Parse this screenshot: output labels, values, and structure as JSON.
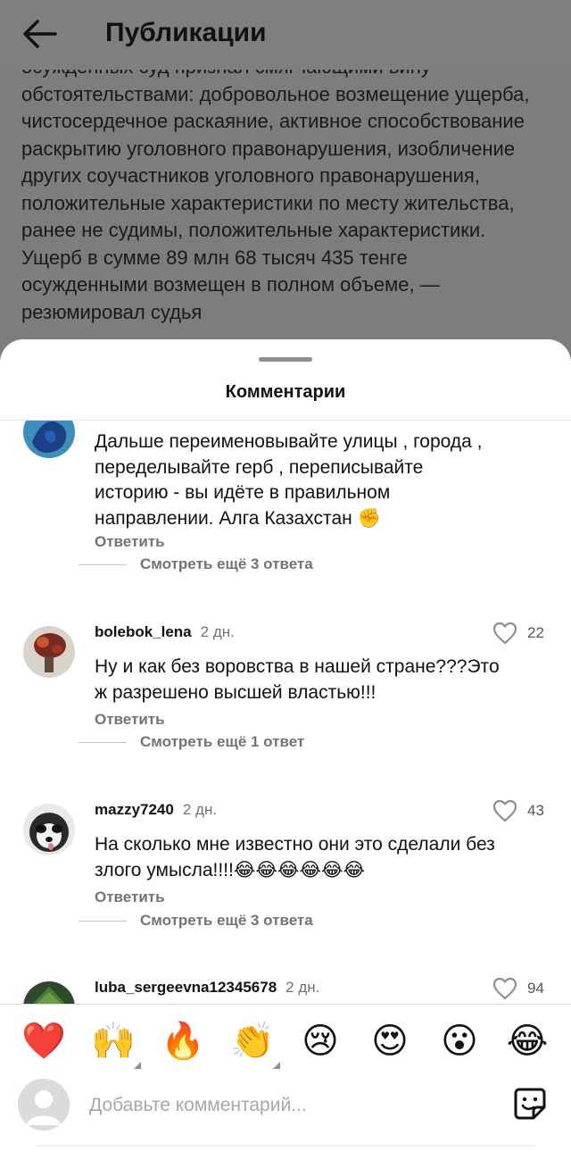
{
  "header": {
    "title": "Публикации",
    "back_icon": "arrow-left-icon"
  },
  "post_text": {
    "lines": [
      "осужденных суд признал смягчающими вину",
      "обстоятельствами: добровольное возмещение ущерба,",
      "чистосердечное раскаяние, активное способствование",
      "раскрытию уголовного правонарушения, изобличение",
      "других соучастников уголовного правонарушения,",
      "положительные характеристики по месту жительства,",
      "ранее не судимы, положительные характеристики.",
      "Ущерб в сумме 89 млн 68 тысяч 435 тенге",
      "осужденными возмещен в полном объеме, —",
      "резюмировал судья"
    ]
  },
  "sheet": {
    "title": "Комментарии"
  },
  "comments": [
    {
      "user": "",
      "time": "",
      "text_lines": [
        "Дальше переименовывайте улицы , города ,",
        "переделывайте герб , переписывайте",
        "историю - вы идёте в правильном",
        "направлении. Алга Казахстан ✊"
      ],
      "reply": "Ответить",
      "view_replies": "Смотреть ещё 3 ответа"
    },
    {
      "user": "bolebok_lena",
      "time": "2 дн.",
      "likes": "22",
      "text_lines": [
        "Ну и как без воровства в нашей стране???Это",
        "ж разрешено высшей властью!!!"
      ],
      "reply": "Ответить",
      "view_replies": "Смотреть ещё 1 ответ"
    },
    {
      "user": "mazzy7240",
      "time": "2 дн.",
      "likes": "43",
      "text_lines": [
        "На сколько мне известно они это сделали без",
        "злого умысла!!!!😂😂😂😂😂😂"
      ],
      "reply": "Ответить",
      "view_replies": "Смотреть ещё 3 ответа"
    },
    {
      "user": "luba_sergeevna12345678",
      "time": "2 дн.",
      "likes": "94"
    }
  ],
  "reactions": [
    "❤️",
    "🙌",
    "🔥",
    "👏",
    "😢",
    "😍",
    "😮",
    "😂"
  ],
  "input": {
    "placeholder": "Добавьте комментарий...",
    "sticker_icon": "sticker-icon"
  },
  "colors": {
    "overlay": "#7f7f7f",
    "muted_text": "#737373",
    "like_icon": "#8e8e8e"
  }
}
